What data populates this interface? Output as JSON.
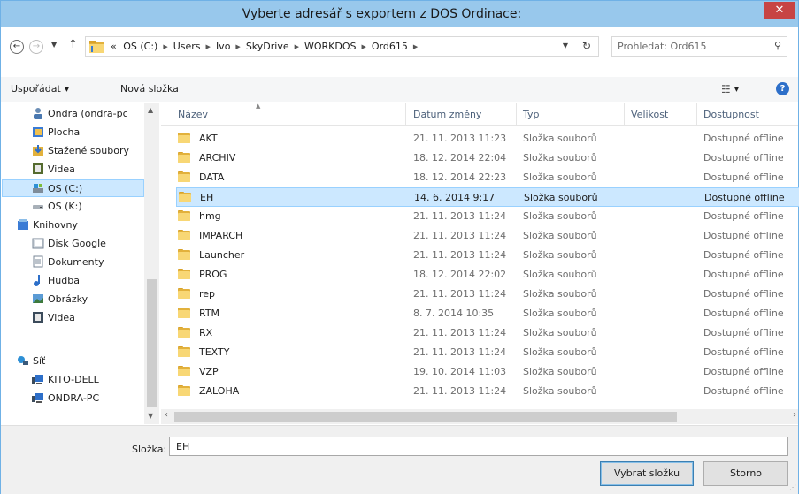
{
  "window": {
    "title": "Vyberte adresář s exportem z DOS Ordinace:",
    "close_glyph": "✕"
  },
  "address_bar": {
    "overflow": "«",
    "crumbs": [
      "OS (C:)",
      "Users",
      "Ivo",
      "SkyDrive",
      "WORKDOS",
      "Ord615"
    ],
    "search_placeholder": "Prohledat: Ord615"
  },
  "toolbar": {
    "organize": "Uspořádat",
    "new_folder": "Nová složka",
    "help": "?"
  },
  "nav": {
    "items": [
      {
        "label": "Ondra (ondra-pc",
        "icon": "homegroup-user-icon",
        "indent": 1
      },
      {
        "label": "Plocha",
        "icon": "desktop-icon",
        "indent": 1
      },
      {
        "label": "Stažené soubory",
        "icon": "downloads-icon",
        "indent": 1
      },
      {
        "label": "Videa",
        "icon": "videos-icon",
        "indent": 1
      },
      {
        "label": "OS (C:)",
        "icon": "drive-c-icon",
        "indent": 1,
        "selected": true
      },
      {
        "label": "OS (K:)",
        "icon": "drive-k-icon",
        "indent": 1
      },
      {
        "label": "Knihovny",
        "icon": "libraries-icon",
        "indent": 0
      },
      {
        "label": "Disk Google",
        "icon": "library-icon",
        "indent": 1
      },
      {
        "label": "Dokumenty",
        "icon": "documents-icon",
        "indent": 1
      },
      {
        "label": "Hudba",
        "icon": "music-icon",
        "indent": 1
      },
      {
        "label": "Obrázky",
        "icon": "pictures-icon",
        "indent": 1
      },
      {
        "label": "Videa",
        "icon": "videos-icon",
        "indent": 1
      },
      {
        "label": "Síť",
        "icon": "network-icon",
        "indent": 0
      },
      {
        "label": "KITO-DELL",
        "icon": "computer-icon",
        "indent": 1
      },
      {
        "label": "ONDRA-PC",
        "icon": "computer-icon",
        "indent": 1
      }
    ]
  },
  "columns": {
    "name": "Název",
    "date": "Datum změny",
    "type": "Typ",
    "size": "Velikost",
    "availability": "Dostupnost"
  },
  "rows": [
    {
      "name": "AKT",
      "date": "21. 11. 2013 11:23",
      "type": "Složka souborů",
      "size": "",
      "availability": "Dostupné offline"
    },
    {
      "name": "ARCHIV",
      "date": "18. 12. 2014 22:04",
      "type": "Složka souborů",
      "size": "",
      "availability": "Dostupné offline"
    },
    {
      "name": "DATA",
      "date": "18. 12. 2014 22:23",
      "type": "Složka souborů",
      "size": "",
      "availability": "Dostupné offline"
    },
    {
      "name": "EH",
      "date": "14. 6. 2014 9:17",
      "type": "Složka souborů",
      "size": "",
      "availability": "Dostupné offline",
      "selected": true
    },
    {
      "name": "hmg",
      "date": "21. 11. 2013 11:24",
      "type": "Složka souborů",
      "size": "",
      "availability": "Dostupné offline"
    },
    {
      "name": "IMPARCH",
      "date": "21. 11. 2013 11:24",
      "type": "Složka souborů",
      "size": "",
      "availability": "Dostupné offline"
    },
    {
      "name": "Launcher",
      "date": "21. 11. 2013 11:24",
      "type": "Složka souborů",
      "size": "",
      "availability": "Dostupné offline"
    },
    {
      "name": "PROG",
      "date": "18. 12. 2014 22:02",
      "type": "Složka souborů",
      "size": "",
      "availability": "Dostupné offline"
    },
    {
      "name": "rep",
      "date": "21. 11. 2013 11:24",
      "type": "Složka souborů",
      "size": "",
      "availability": "Dostupné offline"
    },
    {
      "name": "RTM",
      "date": "8. 7. 2014 10:35",
      "type": "Složka souborů",
      "size": "",
      "availability": "Dostupné offline"
    },
    {
      "name": "RX",
      "date": "21. 11. 2013 11:24",
      "type": "Složka souborů",
      "size": "",
      "availability": "Dostupné offline"
    },
    {
      "name": "TEXTY",
      "date": "21. 11. 2013 11:24",
      "type": "Složka souborů",
      "size": "",
      "availability": "Dostupné offline"
    },
    {
      "name": "VZP",
      "date": "19. 10. 2014 11:03",
      "type": "Složka souborů",
      "size": "",
      "availability": "Dostupné offline"
    },
    {
      "name": "ZALOHA",
      "date": "21. 11. 2013 11:24",
      "type": "Složka souborů",
      "size": "",
      "availability": "Dostupné offline"
    }
  ],
  "footer": {
    "folder_label": "Složka:",
    "folder_value": "EH",
    "select_button": "Vybrat složku",
    "cancel_button": "Storno"
  },
  "colors": {
    "titlebar": "#98c8ec",
    "close": "#c74444",
    "selection": "#cce8ff",
    "selection_border": "#99d1ff",
    "folder": "#f8d775"
  }
}
